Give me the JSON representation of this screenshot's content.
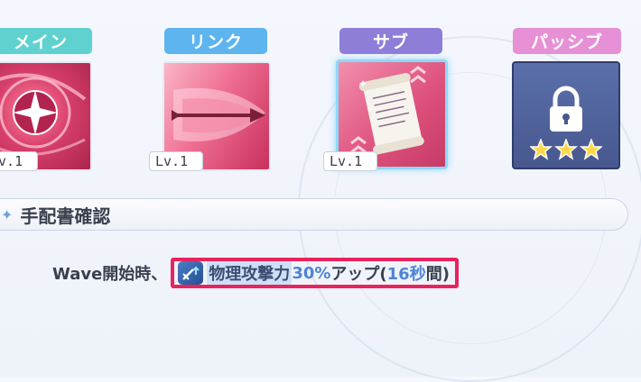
{
  "tabs": {
    "main": "メイン",
    "link": "リンク",
    "sub": "サブ",
    "passive": "パッシブ"
  },
  "levels": {
    "main": "Lv.1",
    "link": "Lv.1",
    "sub": "Lv.1"
  },
  "section": {
    "title": "手配書確認"
  },
  "description": {
    "prefix": "Wave開始時、",
    "stat_name": "物理攻撃力",
    "stat_value": "30%",
    "effect": "アップ(",
    "duration": "16秒",
    "suffix": "間)"
  },
  "passive": {
    "stars": 3
  },
  "colors": {
    "main_tab": "#5fd2cf",
    "link_tab": "#5db4ef",
    "sub_tab": "#8f7ed8",
    "passive_tab": "#e690d6",
    "highlight_border": "#e8235e",
    "value_blue": "#4d84d8"
  },
  "icons": {
    "main": "burst-skill-icon",
    "link": "arrow-skill-icon",
    "sub": "scroll-skill-icon",
    "passive": "lock-icon",
    "buff": "sword-up-icon"
  }
}
